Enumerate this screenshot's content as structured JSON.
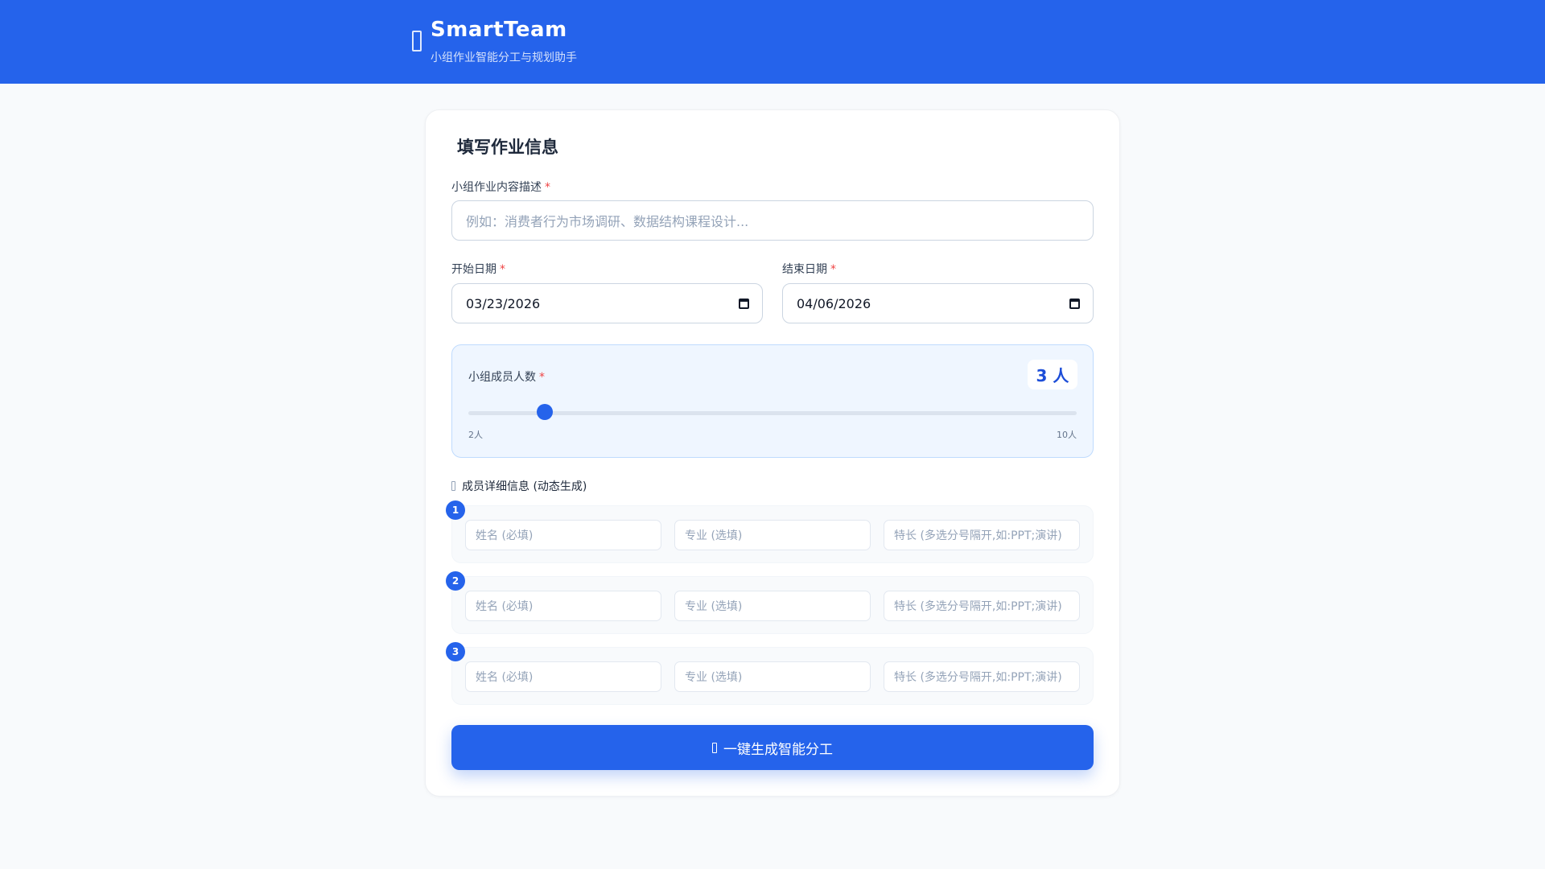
{
  "header": {
    "title": "SmartTeam",
    "subtitle": "小组作业智能分工与规划助手",
    "logo_icon": "team-logo-icon"
  },
  "form": {
    "title": "填写作业信息",
    "description": {
      "label": "小组作业内容描述",
      "required_mark": "*",
      "placeholder": "例如：消费者行为市场调研、数据结构课程设计..."
    },
    "start_date": {
      "label": "开始日期",
      "required_mark": "*",
      "value": "03/23/2026",
      "icon": "calendar-icon"
    },
    "end_date": {
      "label": "结束日期",
      "required_mark": "*",
      "value": "04/06/2026",
      "icon": "calendar-icon"
    },
    "member_count": {
      "label": "小组成员人数",
      "required_mark": "*",
      "value": 3,
      "display": "3 人",
      "min": 2,
      "max": 10,
      "min_label": "2人",
      "max_label": "10人"
    },
    "members_section": {
      "label": "成员详细信息 (动态生成)",
      "icon": "users-icon"
    },
    "members": [
      {
        "number": "1",
        "name_placeholder": "姓名 (必填)",
        "major_placeholder": "专业 (选填)",
        "skills_placeholder": "特长 (多选分号隔开,如:PPT;演讲)"
      },
      {
        "number": "2",
        "name_placeholder": "姓名 (必填)",
        "major_placeholder": "专业 (选填)",
        "skills_placeholder": "特长 (多选分号隔开,如:PPT;演讲)"
      },
      {
        "number": "3",
        "name_placeholder": "姓名 (必填)",
        "major_placeholder": "专业 (选填)",
        "skills_placeholder": "特长 (多选分号隔开,如:PPT;演讲)"
      }
    ],
    "generate_button": {
      "label": "一键生成智能分工",
      "icon": "magic-wand-icon"
    }
  },
  "colors": {
    "primary": "#2563eb",
    "required": "#ef4444",
    "background": "#f8fafc"
  }
}
